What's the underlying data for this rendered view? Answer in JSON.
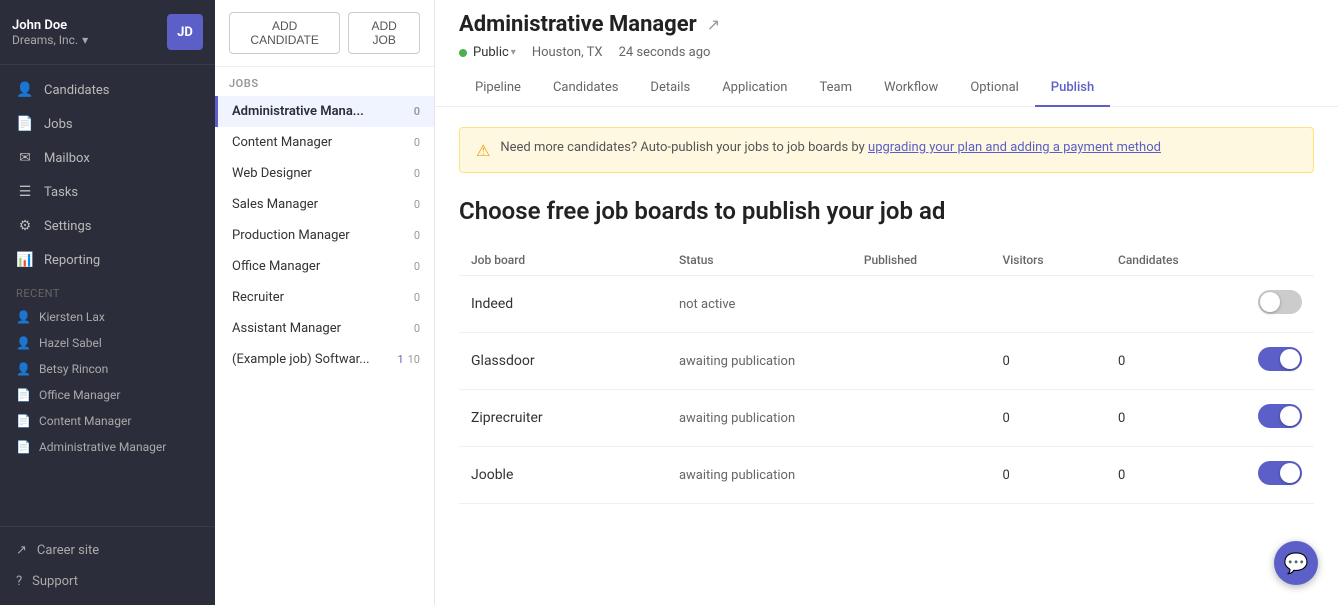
{
  "sidebar": {
    "user": {
      "name": "John Doe",
      "company": "Dreams, Inc.",
      "avatar": "JD"
    },
    "nav_items": [
      {
        "id": "candidates",
        "label": "Candidates",
        "icon": "👤"
      },
      {
        "id": "jobs",
        "label": "Jobs",
        "icon": "📄"
      },
      {
        "id": "mailbox",
        "label": "Mailbox",
        "icon": "✉"
      },
      {
        "id": "tasks",
        "label": "Tasks",
        "icon": "☰"
      },
      {
        "id": "settings",
        "label": "Settings",
        "icon": "⚙"
      },
      {
        "id": "reporting",
        "label": "Reporting",
        "icon": "📊"
      }
    ],
    "recent_label": "RECENT",
    "recent_items": [
      {
        "id": "kiersten",
        "label": "Kiersten Lax",
        "type": "person"
      },
      {
        "id": "hazel",
        "label": "Hazel Sabel",
        "type": "person"
      },
      {
        "id": "betsy",
        "label": "Betsy Rincon",
        "type": "person"
      },
      {
        "id": "office-mgr",
        "label": "Office Manager",
        "type": "doc"
      },
      {
        "id": "content-mgr",
        "label": "Content Manager",
        "type": "doc"
      },
      {
        "id": "admin-mgr",
        "label": "Administrative Manager",
        "type": "doc"
      }
    ],
    "bottom_items": [
      {
        "id": "career-site",
        "label": "Career site",
        "icon": "↗"
      },
      {
        "id": "support",
        "label": "Support",
        "icon": "?"
      }
    ]
  },
  "job_list": {
    "buttons": {
      "add_candidate": "ADD CANDIDATE",
      "add_job": "ADD JOB"
    },
    "section_label": "JOBS",
    "jobs": [
      {
        "id": "admin-manager",
        "name": "Administrative Mana...",
        "count": "0",
        "active": true
      },
      {
        "id": "content-manager",
        "name": "Content Manager",
        "count": "0",
        "active": false
      },
      {
        "id": "web-designer",
        "name": "Web Designer",
        "count": "0",
        "active": false
      },
      {
        "id": "sales-manager",
        "name": "Sales Manager",
        "count": "0",
        "active": false
      },
      {
        "id": "production-manager",
        "name": "Production Manager",
        "count": "0",
        "active": false
      },
      {
        "id": "office-manager",
        "name": "Office Manager",
        "count": "0",
        "active": false
      },
      {
        "id": "recruiter",
        "name": "Recruiter",
        "count": "0",
        "active": false
      },
      {
        "id": "assistant-manager",
        "name": "Assistant Manager",
        "count": "0",
        "active": false
      },
      {
        "id": "example-job",
        "name": "(Example job) Softwar...",
        "count1": "1",
        "count2": "10",
        "active": false
      }
    ]
  },
  "main": {
    "job_title": "Administrative Manager",
    "status": "Public",
    "location": "Houston, TX",
    "timestamp": "24 seconds ago",
    "tabs": [
      {
        "id": "pipeline",
        "label": "Pipeline",
        "active": false
      },
      {
        "id": "candidates",
        "label": "Candidates",
        "active": false
      },
      {
        "id": "details",
        "label": "Details",
        "active": false
      },
      {
        "id": "application",
        "label": "Application",
        "active": false
      },
      {
        "id": "team",
        "label": "Team",
        "active": false
      },
      {
        "id": "workflow",
        "label": "Workflow",
        "active": false
      },
      {
        "id": "optional",
        "label": "Optional",
        "active": false
      },
      {
        "id": "publish",
        "label": "Publish",
        "active": true
      }
    ],
    "alert": {
      "message": "Need more candidates? Auto-publish your jobs to job boards by ",
      "link_text": "upgrading your plan and adding a payment method"
    },
    "publish_heading": "Choose free job boards to publish your job ad",
    "table_headers": {
      "board": "Job board",
      "status": "Status",
      "published": "Published",
      "visitors": "Visitors",
      "candidates": "Candidates"
    },
    "job_boards": [
      {
        "id": "indeed",
        "name": "Indeed",
        "status": "not active",
        "published": "",
        "visitors": "",
        "candidates": "",
        "enabled": false
      },
      {
        "id": "glassdoor",
        "name": "Glassdoor",
        "status": "awaiting publication",
        "published": "",
        "visitors": "0",
        "candidates": "0",
        "enabled": true
      },
      {
        "id": "ziprecruiter",
        "name": "Ziprecruiter",
        "status": "awaiting publication",
        "published": "",
        "visitors": "0",
        "candidates": "0",
        "enabled": true
      },
      {
        "id": "jooble",
        "name": "Jooble",
        "status": "awaiting publication",
        "published": "",
        "visitors": "0",
        "candidates": "0",
        "enabled": true
      }
    ]
  },
  "chat_fab_icon": "💬"
}
